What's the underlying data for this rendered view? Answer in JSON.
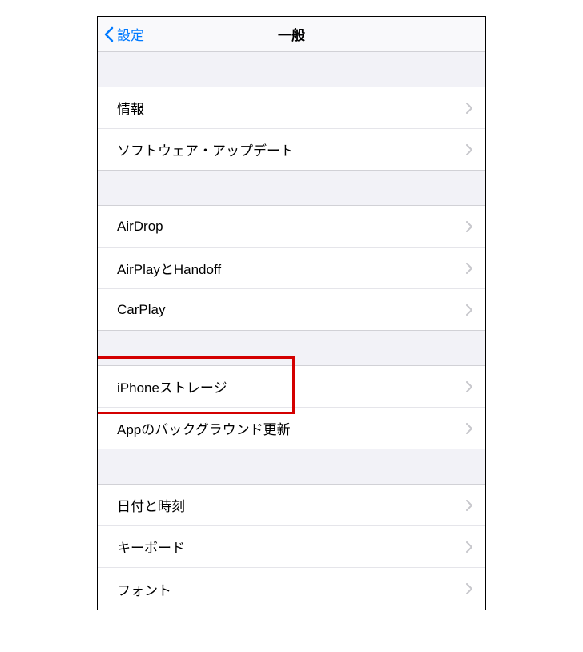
{
  "nav": {
    "back_label": "設定",
    "title": "一般"
  },
  "sections": [
    {
      "rows": [
        {
          "label": "情報"
        },
        {
          "label": "ソフトウェア・アップデート"
        }
      ]
    },
    {
      "rows": [
        {
          "label": "AirDrop"
        },
        {
          "label": "AirPlayとHandoff"
        },
        {
          "label": "CarPlay"
        }
      ]
    },
    {
      "rows": [
        {
          "label": "iPhoneストレージ",
          "highlighted": true
        },
        {
          "label": "Appのバックグラウンド更新"
        }
      ]
    },
    {
      "rows": [
        {
          "label": "日付と時刻"
        },
        {
          "label": "キーボード"
        },
        {
          "label": "フォント"
        }
      ]
    }
  ]
}
